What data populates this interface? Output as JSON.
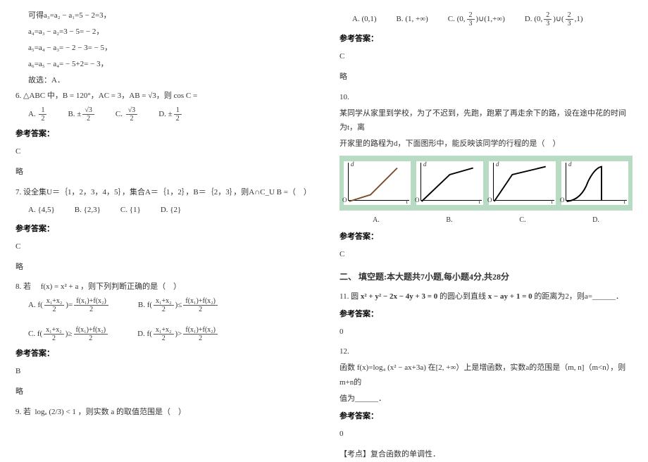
{
  "left": {
    "g1": "可得a₃=a₂ − a₁=5 − 2=3，",
    "g2": "a₄=a₃ − a₂=3 − 5= − 2，",
    "g3": "a₅=a₄ − a₃= − 2 − 3= − 5，",
    "g4": "a₆=a₅ − a₄= − 5+2= − 3，",
    "g5": "故选：A．",
    "q6_text": "6. △ABC 中，B = 120°，AC = 3，AB = √3，则 cos C =",
    "q6_A": "A.",
    "q6_B": "B.",
    "q6_C": "C.",
    "q6_D": "D.",
    "frac_half_num": "1",
    "frac_half_den": "2",
    "frac_s3_num": "√3",
    "frac_s3_den": "2",
    "ans_label": "参考答案：",
    "q6_ans": "C",
    "q6_brief": "略",
    "q7_text": "7. 设全集U＝｛1，2，3，4，5｝，集合A＝｛1，2｝，B＝｛2，3｝，则A∩C_U B =（　）",
    "q7_A": "A.",
    "q7_B": "B.",
    "q7_C": "C.",
    "q7_D": "D.",
    "q7_opt_A": "{4,5}",
    "q7_opt_B": "{2,3}",
    "q7_opt_C": "{1}",
    "q7_opt_D": "{2}",
    "q7_ans": "C",
    "q7_brief": "略",
    "q8_text": "8. 若",
    "q8_fx": "f(x) = x² + a",
    "q8_tail": "，则下列判断正确的是（　）",
    "q8_A": "A.",
    "q8_B": "B.",
    "q8_C": "C.",
    "q8_D": "D.",
    "q8_ans": "B",
    "q8_brief": "略",
    "q9_text": "9. 若",
    "q9_expr": "logₐ (2/3) < 1",
    "q9_tail": "，则实数 a 的取值范围是（　）"
  },
  "right": {
    "q9_A": "A.",
    "q9_B": "B.",
    "q9_C": "C.",
    "q9_D": "D.",
    "q9_opt_A": "(0,1)",
    "q9_opt_B": "(1, +∞)",
    "q9_opt_C_pre": "(0,",
    "q9_opt_C_mid": ")∪(1,+∞)",
    "q9_opt_D_pre": "(0,",
    "q9_opt_D_mid": ")∪(",
    "q9_opt_D_post": ",1)",
    "frac23_num": "2",
    "frac23_den": "3",
    "ans_label": "参考答案：",
    "q9_ans": "C",
    "q9_brief": "略",
    "q10_num": "10.",
    "q10_text1": "某同学从家里到学校，为了不迟到，先跑，跑累了再走余下的路，设在途中花的时间为t，离",
    "q10_text2": "开家里的路程为d，下面图形中，能反映该同学的行程的是（　）",
    "axis_d": "d",
    "axis_t": "t",
    "axis_o": "O",
    "sub_A": "A.",
    "sub_B": "B.",
    "sub_C": "C.",
    "sub_D": "D.",
    "q10_ans": "C",
    "section2": "二、 填空题:本大题共7小题,每小题4分,共28分",
    "q11_text_pre": "11. 圆 ",
    "q11_formula": "x² + y² − 2x − 4y + 3 = 0",
    "q11_mid": " 的圆心到直线 ",
    "q11_line": "x − ay + 1 = 0",
    "q11_tail": " 的距离为2，则a=______．",
    "q11_ans": "0",
    "q12_num": "12.",
    "q12_pre": "函数 ",
    "q12_fx": "f(x)=log₄ (x² − ax+3a)",
    "q12_mid": " 在[2, +∞）上是增函数，实数a的范围是（m, n]（m<n），则m+n的",
    "q12_tail": "值为______．",
    "q12_ans": "0",
    "q12_note": "【考点】复合函数的单调性．"
  }
}
